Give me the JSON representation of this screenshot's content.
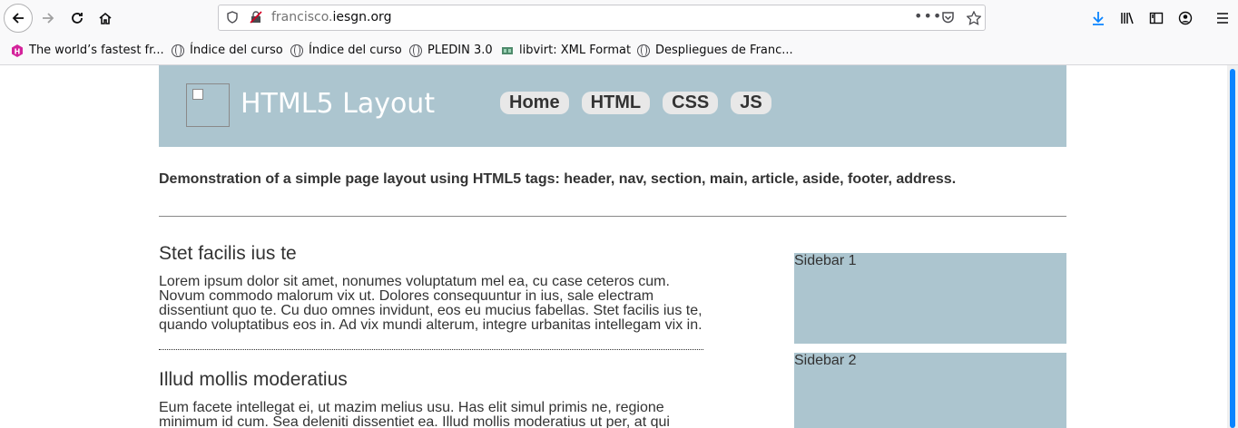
{
  "browser": {
    "url_prefix": "francisco.",
    "url_domain": "iesgn.org",
    "bookmarks": [
      "The world’s fastest fr...",
      "Índice del curso",
      "Índice del curso",
      "PLEDIN 3.0",
      "libvirt: XML Format",
      "Despliegues de Franc..."
    ]
  },
  "page": {
    "site_title": "HTML5 Layout",
    "nav": [
      "Home",
      "HTML",
      "CSS",
      "JS"
    ],
    "intro": "Demonstration of a simple page layout using HTML5 tags: header, nav, section, main, article, aside, footer, address.",
    "articles": [
      {
        "title": "Stet facilis ius te",
        "lines": [
          "Lorem ipsum dolor sit amet, nonumes voluptatum mel ea, cu case ceteros cum.",
          "Novum commodo malorum vix ut. Dolores consequuntur in ius, sale electram",
          "dissentiunt quo te. Cu duo omnes invidunt, eos eu mucius fabellas. Stet facilis ius te,",
          "quando voluptatibus eos in. Ad vix mundi alterum, integre urbanitas intellegam vix in."
        ]
      },
      {
        "title": "Illud mollis moderatius",
        "lines": [
          "Eum facete intellegat ei, ut mazim melius usu. Has elit simul primis ne, regione",
          "minimum id cum. Sea deleniti dissentiet ea. Illud mollis moderatius ut per, at qui"
        ]
      }
    ],
    "sidebars": [
      "Sidebar 1",
      "Sidebar 2"
    ]
  },
  "icons": [
    "back-arrow-icon",
    "forward-arrow-icon",
    "reload-icon",
    "home-icon",
    "shield-icon",
    "insecure-lock-icon",
    "more-icon",
    "pocket-icon",
    "star-icon",
    "download-icon",
    "library-icon",
    "sidebar-icon",
    "account-icon",
    "menu-icon"
  ]
}
